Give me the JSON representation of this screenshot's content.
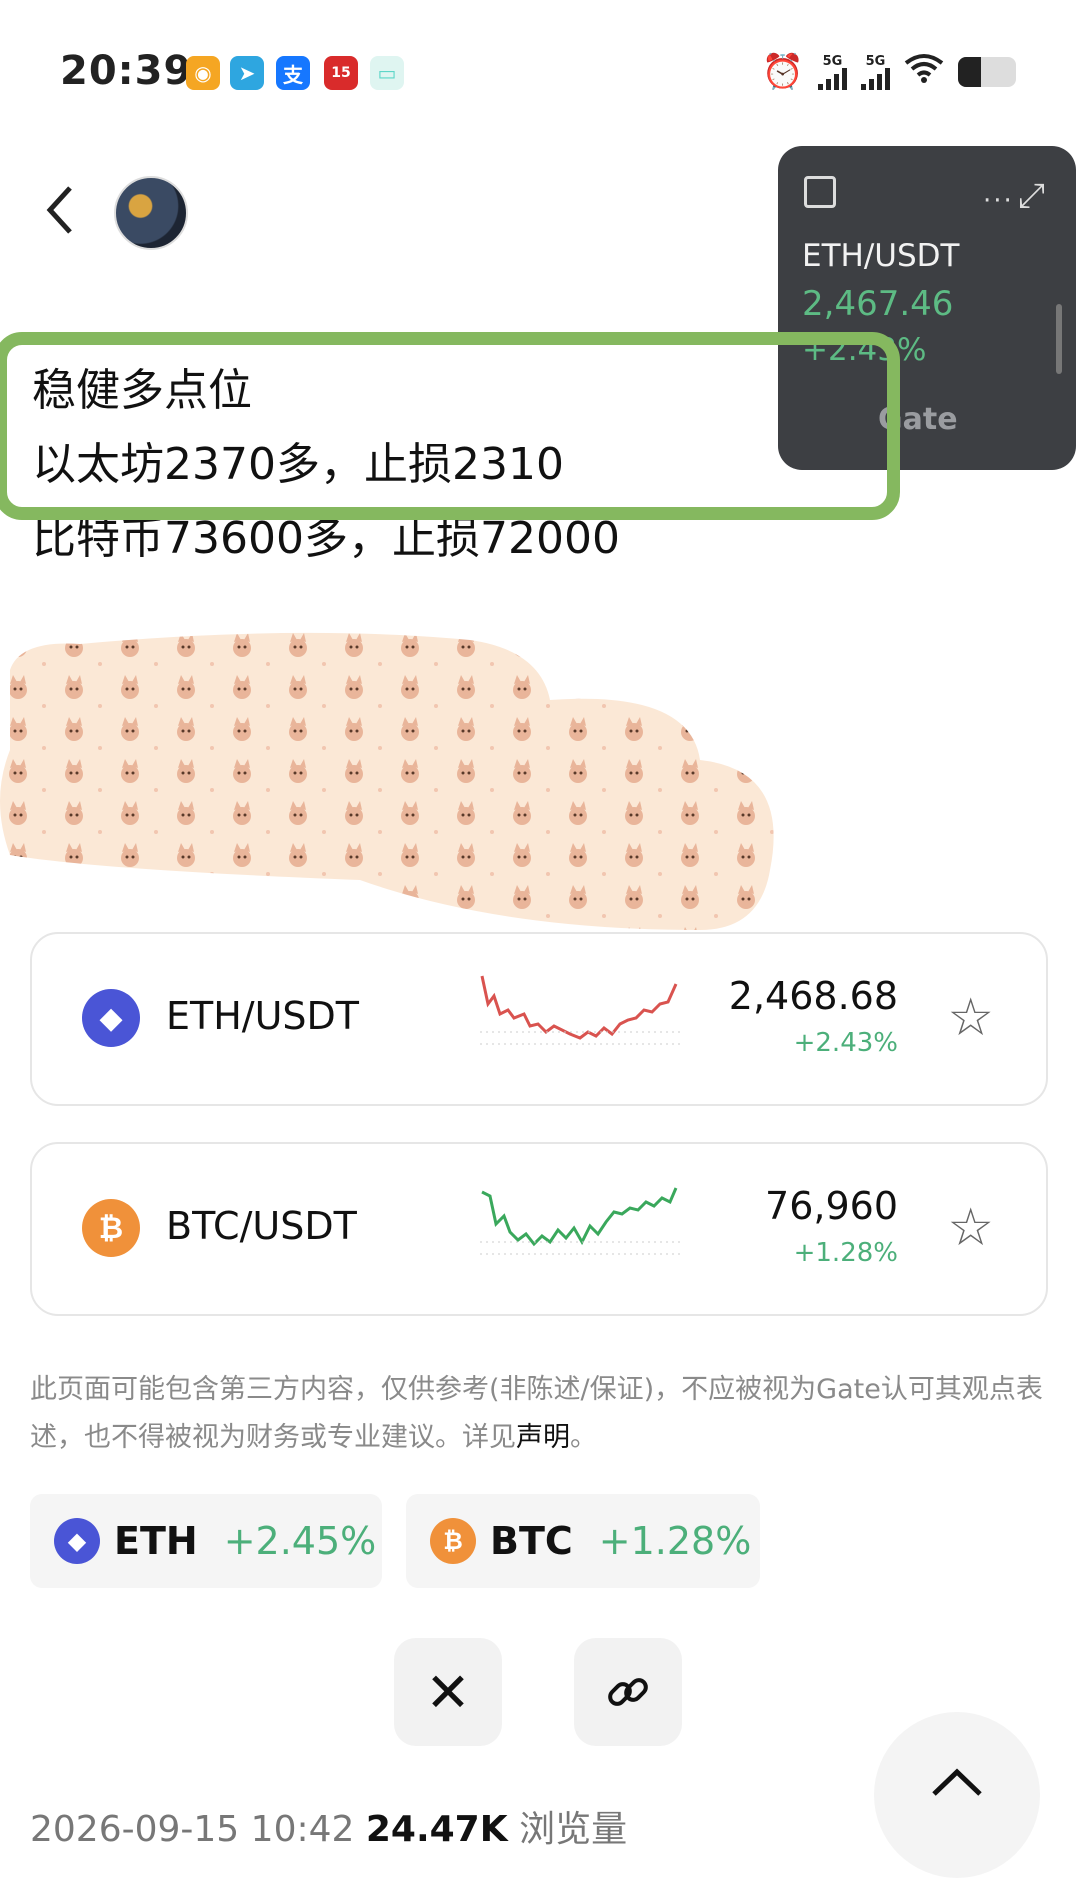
{
  "status_bar": {
    "time": "20:39",
    "apps": [
      {
        "name": "weibo-icon",
        "color": "#f5a623",
        "glyph": "微"
      },
      {
        "name": "telegram-icon",
        "color": "#2ea6e0",
        "glyph": "➤"
      },
      {
        "name": "alipay-icon",
        "color": "#1677ff",
        "glyph": "支"
      },
      {
        "name": "lottery-icon",
        "color": "#d92b2b",
        "glyph": "15"
      },
      {
        "name": "chat-icon",
        "color": "#5ed6c8",
        "glyph": "▭"
      }
    ],
    "network_1": "5G",
    "network_2": "5G"
  },
  "header": {
    "back_icon": "chevron-left-icon",
    "avatar": "author-avatar"
  },
  "floating_widget": {
    "pair": "ETH/USDT",
    "price": "2,467.46",
    "change": "+2.43%",
    "brand": "Gate"
  },
  "post": {
    "line1": "稳健多点位",
    "line2": "以太坊2370多，止损2310",
    "line3": "比特币73600多，止损72000"
  },
  "tickers": [
    {
      "pair": "ETH/USDT",
      "price": "2,468.68",
      "change": "+2.43%",
      "coin_color": "#4a55d6",
      "trend_color": "#d9534f"
    },
    {
      "pair": "BTC/USDT",
      "price": "76,960",
      "change": "+1.28%",
      "coin_color": "#f0913a",
      "trend_color": "#3aa85c"
    }
  ],
  "disclaimer": {
    "text": "此页面可能包含第三方内容，仅供参考(非陈述/保证)，不应被视为Gate认可其观点表述，也不得被视为财务或专业建议。详见",
    "link": "声明",
    "end": "。"
  },
  "chips": [
    {
      "symbol": "ETH",
      "change": "+2.45%"
    },
    {
      "symbol": "BTC",
      "change": "+1.28%"
    }
  ],
  "share": {
    "x_label": "𝕏"
  },
  "meta": {
    "timestamp": "2026-09-15 10:42",
    "views": "24.47K",
    "views_label": "浏览量"
  }
}
